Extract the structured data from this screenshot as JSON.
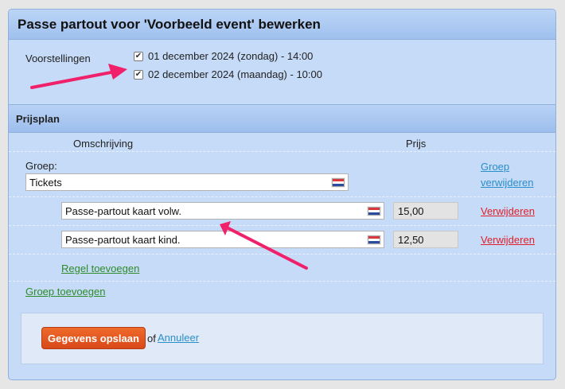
{
  "panel": {
    "title": "Passe partout voor 'Voorbeeld event' bewerken"
  },
  "voorstellingen": {
    "label": "Voorstellingen",
    "items": [
      {
        "label": "01 december 2024 (zondag) - 14:00",
        "checked": true
      },
      {
        "label": "02 december 2024 (maandag) - 10:00",
        "checked": true
      }
    ]
  },
  "prijsplan": {
    "title": "Prijsplan",
    "col_description": "Omschrijving",
    "col_price": "Prijs",
    "group": {
      "label": "Groep:",
      "name": "Tickets",
      "remove_label_line1": "Groep",
      "remove_label_line2": "verwijderen",
      "rows": [
        {
          "description": "Passe-partout kaart volw.",
          "price": "15,00",
          "remove_label": "Verwijderen"
        },
        {
          "description": "Passe-partout kaart kind.",
          "price": "12,50",
          "remove_label": "Verwijderen"
        }
      ],
      "add_row_label": "Regel toevoegen"
    },
    "add_group_label": "Groep toevoegen"
  },
  "footer": {
    "save_label": "Gegevens opslaan",
    "or_text": "of",
    "cancel_label": "Annuleer"
  },
  "icons": {
    "language_flag": "dutch-flag-icon",
    "annotation_arrow": "arrow-icon"
  },
  "colors": {
    "panel_bg": "#c6dbf7",
    "save_button": "#e65a22",
    "remove_link": "#e0202a",
    "add_link": "#2e8b2a",
    "info_link": "#2a8ec9",
    "arrow": "#f0206a"
  }
}
